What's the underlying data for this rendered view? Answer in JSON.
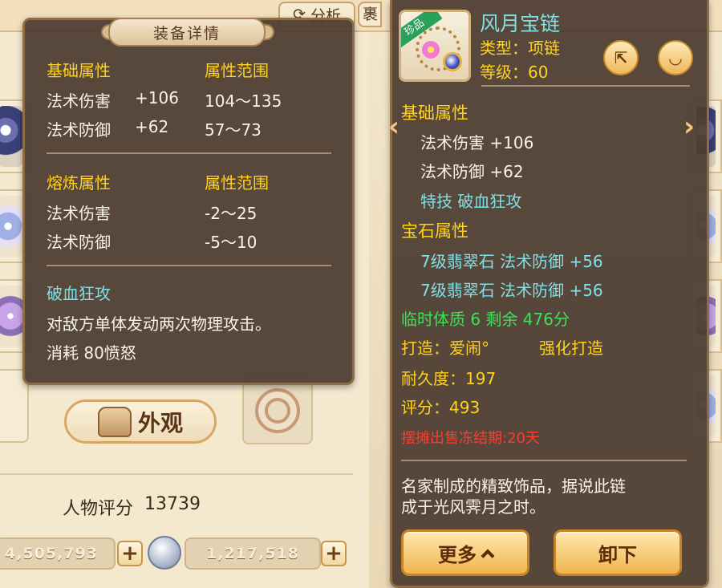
{
  "top_tabs": {
    "analyze_label": "分析",
    "partial_tab_label": "裹"
  },
  "left_panel": {
    "title": "装备详情",
    "base_header": "基础属性",
    "range_header": "属性范围",
    "base_attrs": [
      {
        "name": "法术伤害",
        "value": "+106",
        "range": "104～135"
      },
      {
        "name": "法术防御",
        "value": "+62",
        "range": "57～73"
      }
    ],
    "forge_header": "熔炼属性",
    "forge_range_header": "属性范围",
    "forge_attrs": [
      {
        "name": "法术伤害",
        "range": "-2～25"
      },
      {
        "name": "法术防御",
        "range": "-5～10"
      }
    ],
    "skill_name": "破血狂攻",
    "skill_desc": "对敌方单体发动两次物理攻击。",
    "skill_cost": "消耗 80愤怒"
  },
  "background": {
    "appearance_label": "外观",
    "score_label": "人物评分",
    "score_value": "13739",
    "currency_1": "4,505,793",
    "currency_2": "1,217,518",
    "plus_symbol": "+"
  },
  "right_panel": {
    "badge": "珍品",
    "item_name": "风月宝链",
    "type_line": "类型：项链",
    "level_line": "等级：60",
    "base_header": "基础属性",
    "base_attrs": [
      "法术伤害 +106",
      "法术防御 +62"
    ],
    "special_skill": "特技  破血狂攻",
    "gem_header": "宝石属性",
    "gem_attrs": [
      "7级翡翠石  法术防御 +56",
      "7级翡翠石  法术防御 +56"
    ],
    "temp_stat": "临时体质 6 剩余 476分",
    "crafted_by": "打造：爱闹°",
    "enhanced": "强化打造",
    "durability": "耐久度：197",
    "rating": "评分：493",
    "trade_notice": "摆摊出售冻结期:20天",
    "description_1": "名家制成的精致饰品，据说此链",
    "description_2": "成于光风霁月之时。",
    "more_button": "更多",
    "unequip_button": "卸下",
    "nav_prev": "‹",
    "nav_next": "›"
  },
  "colors": {
    "panel_bg": "#4e3e32",
    "yellow_text": "#ffd21f",
    "cyan_text": "#7fe0e6",
    "green_text": "#3ee05a",
    "red_text": "#ff3b2b"
  }
}
